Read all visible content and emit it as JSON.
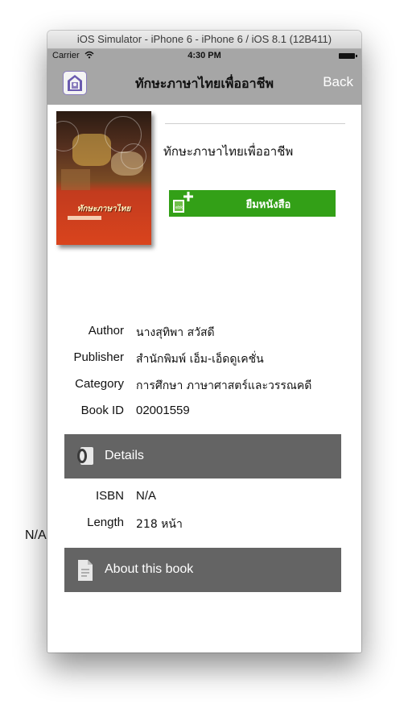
{
  "simulator": {
    "title": "iOS Simulator - iPhone 6 - iPhone 6 / iOS 8.1 (12B411)"
  },
  "status_bar": {
    "carrier": "Carrier",
    "time": "4:30 PM"
  },
  "nav": {
    "title": "ทักษะภาษาไทยเพื่ออาชีพ",
    "back_label": "Back"
  },
  "book": {
    "title": "ทักษะภาษาไทยเพื่ออาชีพ",
    "cover_text": "ทักษะภาษาไทย",
    "borrow_label": "ยืมหนังสือ",
    "metadata": [
      {
        "key": "Author",
        "value": "นางสุทิพา  สวัสดี"
      },
      {
        "key": "Publisher",
        "value": "สำนักพิมพ์ เอ็ม-เอ็ดดูเคชั่น"
      },
      {
        "key": "Category",
        "value": "การศึกษา ภาษาศาสตร์และวรรณคดี"
      },
      {
        "key": "Book ID",
        "value": "02001559"
      }
    ]
  },
  "details": {
    "header": "Details",
    "rows": [
      {
        "key": "ISBN",
        "value": "N/A"
      },
      {
        "key": "Length",
        "value": "218 หน้า"
      }
    ]
  },
  "about": {
    "header": "About this book",
    "text": "N/A"
  },
  "colors": {
    "nav_bg": "#a6a6a6",
    "borrow_green": "#33a017",
    "section_gray": "#646464"
  }
}
